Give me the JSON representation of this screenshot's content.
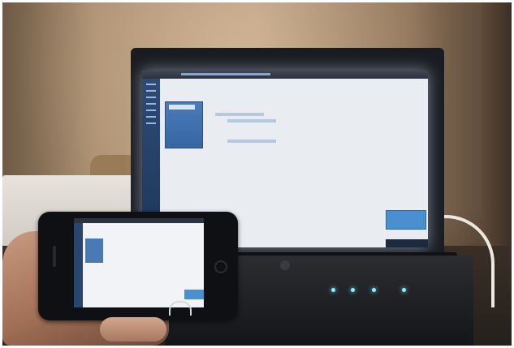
{
  "scene": {
    "colors": {
      "wall": "#b89a7a",
      "screen_glow": "#e9edf2",
      "sidebar_blue": "#2e4b77",
      "tile_blue": "#4a7ab6",
      "led": "#8cf0ff"
    }
  }
}
